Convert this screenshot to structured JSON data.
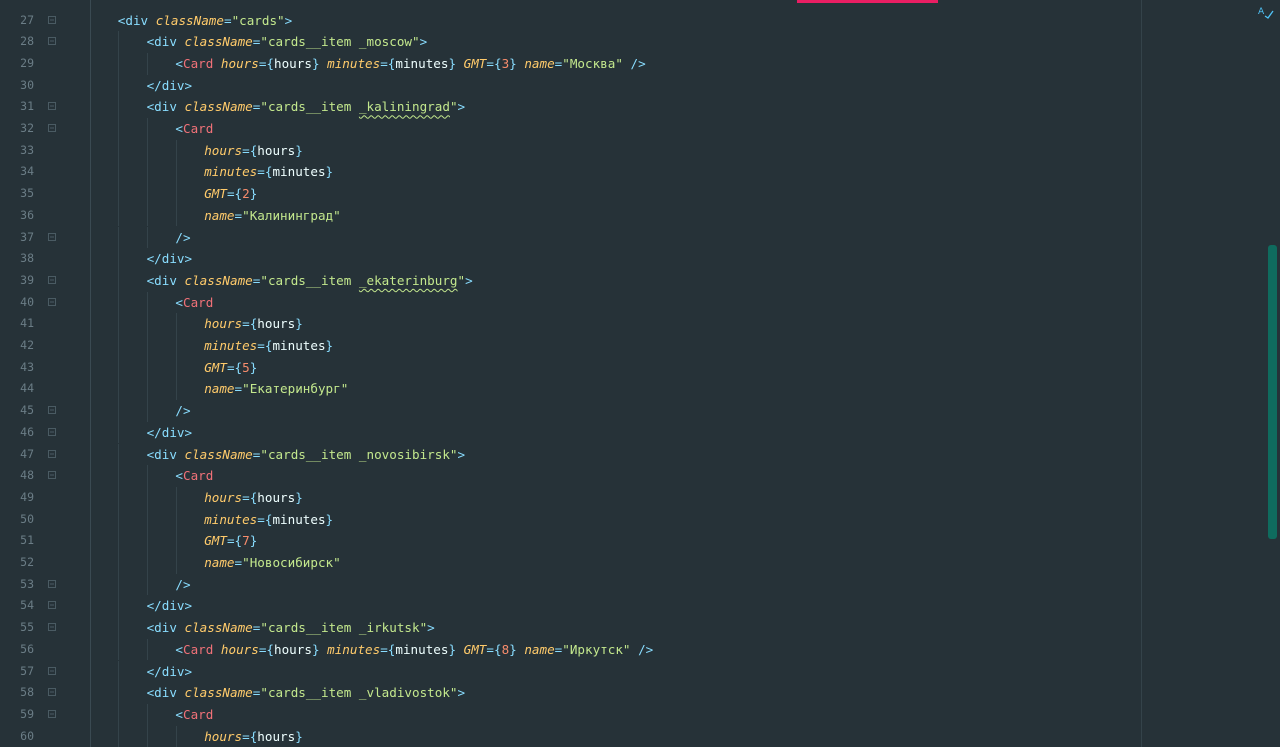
{
  "editor": {
    "lines": [
      {
        "n": "27",
        "indent": 1,
        "fold": true,
        "tokens": [
          [
            "t-tag",
            "<div "
          ],
          [
            "t-attr",
            "className"
          ],
          [
            "t-eq",
            "="
          ],
          [
            "t-str",
            "\"cards\""
          ],
          [
            "t-tag",
            ">"
          ]
        ]
      },
      {
        "n": "28",
        "indent": 2,
        "fold": true,
        "tokens": [
          [
            "t-tag",
            "<div "
          ],
          [
            "t-attr",
            "className"
          ],
          [
            "t-eq",
            "="
          ],
          [
            "t-str",
            "\"cards__item _moscow\""
          ],
          [
            "t-tag",
            ">"
          ]
        ]
      },
      {
        "n": "29",
        "indent": 3,
        "fold": false,
        "tokens": [
          [
            "t-tag",
            "<"
          ],
          [
            "t-comp",
            "Card "
          ],
          [
            "t-attr",
            "hours"
          ],
          [
            "t-eq",
            "="
          ],
          [
            "t-brace",
            "{"
          ],
          [
            "t-var",
            "hours"
          ],
          [
            "t-brace",
            "} "
          ],
          [
            "t-attr",
            "minutes"
          ],
          [
            "t-eq",
            "="
          ],
          [
            "t-brace",
            "{"
          ],
          [
            "t-var",
            "minutes"
          ],
          [
            "t-brace",
            "} "
          ],
          [
            "t-attr",
            "GMT"
          ],
          [
            "t-eq",
            "="
          ],
          [
            "t-brace",
            "{"
          ],
          [
            "t-num",
            "3"
          ],
          [
            "t-brace",
            "} "
          ],
          [
            "t-attr",
            "name"
          ],
          [
            "t-eq",
            "="
          ],
          [
            "t-str",
            "\"Москва\" "
          ],
          [
            "t-tag",
            "/>"
          ]
        ]
      },
      {
        "n": "30",
        "indent": 2,
        "fold": false,
        "tokens": [
          [
            "t-tag",
            "</div>"
          ]
        ]
      },
      {
        "n": "31",
        "indent": 2,
        "fold": true,
        "tokens": [
          [
            "t-tag",
            "<div "
          ],
          [
            "t-attr",
            "className"
          ],
          [
            "t-eq",
            "="
          ],
          [
            "t-str",
            "\"cards__item "
          ],
          [
            "t-str squig",
            "_kaliningrad"
          ],
          [
            "t-str",
            "\""
          ],
          [
            "t-tag",
            ">"
          ]
        ]
      },
      {
        "n": "32",
        "indent": 3,
        "fold": true,
        "tokens": [
          [
            "t-tag",
            "<"
          ],
          [
            "t-comp",
            "Card"
          ]
        ]
      },
      {
        "n": "33",
        "indent": 4,
        "fold": false,
        "tokens": [
          [
            "t-attr",
            "hours"
          ],
          [
            "t-eq",
            "="
          ],
          [
            "t-brace",
            "{"
          ],
          [
            "t-var",
            "hours"
          ],
          [
            "t-brace",
            "}"
          ]
        ]
      },
      {
        "n": "34",
        "indent": 4,
        "fold": false,
        "tokens": [
          [
            "t-attr",
            "minutes"
          ],
          [
            "t-eq",
            "="
          ],
          [
            "t-brace",
            "{"
          ],
          [
            "t-var",
            "minutes"
          ],
          [
            "t-brace",
            "}"
          ]
        ]
      },
      {
        "n": "35",
        "indent": 4,
        "fold": false,
        "tokens": [
          [
            "t-attr",
            "GMT"
          ],
          [
            "t-eq",
            "="
          ],
          [
            "t-brace",
            "{"
          ],
          [
            "t-num",
            "2"
          ],
          [
            "t-brace",
            "}"
          ]
        ]
      },
      {
        "n": "36",
        "indent": 4,
        "fold": false,
        "tokens": [
          [
            "t-attr",
            "name"
          ],
          [
            "t-eq",
            "="
          ],
          [
            "t-str",
            "\"Калининград\""
          ]
        ]
      },
      {
        "n": "37",
        "indent": 3,
        "fold": true,
        "tokens": [
          [
            "t-tag",
            "/>"
          ]
        ]
      },
      {
        "n": "38",
        "indent": 2,
        "fold": false,
        "tokens": [
          [
            "t-tag",
            "</div>"
          ]
        ]
      },
      {
        "n": "39",
        "indent": 2,
        "fold": true,
        "tokens": [
          [
            "t-tag",
            "<div "
          ],
          [
            "t-attr",
            "className"
          ],
          [
            "t-eq",
            "="
          ],
          [
            "t-str",
            "\"cards__item "
          ],
          [
            "t-str squig",
            "_ekaterinburg"
          ],
          [
            "t-str",
            "\""
          ],
          [
            "t-tag",
            ">"
          ]
        ]
      },
      {
        "n": "40",
        "indent": 3,
        "fold": true,
        "tokens": [
          [
            "t-tag",
            "<"
          ],
          [
            "t-comp",
            "Card"
          ]
        ]
      },
      {
        "n": "41",
        "indent": 4,
        "fold": false,
        "tokens": [
          [
            "t-attr",
            "hours"
          ],
          [
            "t-eq",
            "="
          ],
          [
            "t-brace",
            "{"
          ],
          [
            "t-var",
            "hours"
          ],
          [
            "t-brace",
            "}"
          ]
        ]
      },
      {
        "n": "42",
        "indent": 4,
        "fold": false,
        "tokens": [
          [
            "t-attr",
            "minutes"
          ],
          [
            "t-eq",
            "="
          ],
          [
            "t-brace",
            "{"
          ],
          [
            "t-var",
            "minutes"
          ],
          [
            "t-brace",
            "}"
          ]
        ]
      },
      {
        "n": "43",
        "indent": 4,
        "fold": false,
        "tokens": [
          [
            "t-attr",
            "GMT"
          ],
          [
            "t-eq",
            "="
          ],
          [
            "t-brace",
            "{"
          ],
          [
            "t-num",
            "5"
          ],
          [
            "t-brace",
            "}"
          ]
        ]
      },
      {
        "n": "44",
        "indent": 4,
        "fold": false,
        "tokens": [
          [
            "t-attr",
            "name"
          ],
          [
            "t-eq",
            "="
          ],
          [
            "t-str",
            "\"Екатеринбург\""
          ]
        ]
      },
      {
        "n": "45",
        "indent": 3,
        "fold": true,
        "tokens": [
          [
            "t-tag",
            "/>"
          ]
        ]
      },
      {
        "n": "46",
        "indent": 2,
        "fold": true,
        "tokens": [
          [
            "t-tag",
            "</div>"
          ]
        ]
      },
      {
        "n": "47",
        "indent": 2,
        "fold": true,
        "tokens": [
          [
            "t-tag",
            "<div "
          ],
          [
            "t-attr",
            "className"
          ],
          [
            "t-eq",
            "="
          ],
          [
            "t-str",
            "\"cards__item _novosibirsk\""
          ],
          [
            "t-tag",
            ">"
          ]
        ]
      },
      {
        "n": "48",
        "indent": 3,
        "fold": true,
        "tokens": [
          [
            "t-tag",
            "<"
          ],
          [
            "t-comp",
            "Card"
          ]
        ]
      },
      {
        "n": "49",
        "indent": 4,
        "fold": false,
        "tokens": [
          [
            "t-attr",
            "hours"
          ],
          [
            "t-eq",
            "="
          ],
          [
            "t-brace",
            "{"
          ],
          [
            "t-var",
            "hours"
          ],
          [
            "t-brace",
            "}"
          ]
        ]
      },
      {
        "n": "50",
        "indent": 4,
        "fold": false,
        "tokens": [
          [
            "t-attr",
            "minutes"
          ],
          [
            "t-eq",
            "="
          ],
          [
            "t-brace",
            "{"
          ],
          [
            "t-var",
            "minutes"
          ],
          [
            "t-brace",
            "}"
          ]
        ]
      },
      {
        "n": "51",
        "indent": 4,
        "fold": false,
        "tokens": [
          [
            "t-attr",
            "GMT"
          ],
          [
            "t-eq",
            "="
          ],
          [
            "t-brace",
            "{"
          ],
          [
            "t-num",
            "7"
          ],
          [
            "t-brace",
            "}"
          ]
        ]
      },
      {
        "n": "52",
        "indent": 4,
        "fold": false,
        "tokens": [
          [
            "t-attr",
            "name"
          ],
          [
            "t-eq",
            "="
          ],
          [
            "t-str",
            "\"Новосибирск\""
          ]
        ]
      },
      {
        "n": "53",
        "indent": 3,
        "fold": true,
        "tokens": [
          [
            "t-tag",
            "/>"
          ]
        ]
      },
      {
        "n": "54",
        "indent": 2,
        "fold": true,
        "tokens": [
          [
            "t-tag",
            "</div>"
          ]
        ]
      },
      {
        "n": "55",
        "indent": 2,
        "fold": true,
        "tokens": [
          [
            "t-tag",
            "<div "
          ],
          [
            "t-attr",
            "className"
          ],
          [
            "t-eq",
            "="
          ],
          [
            "t-str",
            "\"cards__item _irkutsk\""
          ],
          [
            "t-tag",
            ">"
          ]
        ]
      },
      {
        "n": "56",
        "indent": 3,
        "fold": false,
        "tokens": [
          [
            "t-tag",
            "<"
          ],
          [
            "t-comp",
            "Card "
          ],
          [
            "t-attr",
            "hours"
          ],
          [
            "t-eq",
            "="
          ],
          [
            "t-brace",
            "{"
          ],
          [
            "t-var",
            "hours"
          ],
          [
            "t-brace",
            "} "
          ],
          [
            "t-attr",
            "minutes"
          ],
          [
            "t-eq",
            "="
          ],
          [
            "t-brace",
            "{"
          ],
          [
            "t-var",
            "minutes"
          ],
          [
            "t-brace",
            "} "
          ],
          [
            "t-attr",
            "GMT"
          ],
          [
            "t-eq",
            "="
          ],
          [
            "t-brace",
            "{"
          ],
          [
            "t-num",
            "8"
          ],
          [
            "t-brace",
            "} "
          ],
          [
            "t-attr",
            "name"
          ],
          [
            "t-eq",
            "="
          ],
          [
            "t-str",
            "\"Иркутск\" "
          ],
          [
            "t-tag",
            "/>"
          ]
        ]
      },
      {
        "n": "57",
        "indent": 2,
        "fold": true,
        "tokens": [
          [
            "t-tag",
            "</div>"
          ]
        ]
      },
      {
        "n": "58",
        "indent": 2,
        "fold": true,
        "tokens": [
          [
            "t-tag",
            "<div "
          ],
          [
            "t-attr",
            "className"
          ],
          [
            "t-eq",
            "="
          ],
          [
            "t-str",
            "\"cards__item _vladivostok\""
          ],
          [
            "t-tag",
            ">"
          ]
        ]
      },
      {
        "n": "59",
        "indent": 3,
        "fold": true,
        "tokens": [
          [
            "t-tag",
            "<"
          ],
          [
            "t-comp",
            "Card"
          ]
        ]
      },
      {
        "n": "60",
        "indent": 4,
        "fold": false,
        "tokens": [
          [
            "t-attr",
            "hours"
          ],
          [
            "t-eq",
            "="
          ],
          [
            "t-brace",
            "{"
          ],
          [
            "t-var",
            "hours"
          ],
          [
            "t-brace",
            "}"
          ]
        ]
      }
    ]
  },
  "icons": {
    "fold_marker": "fold-marker-icon",
    "spellcheck": "spellcheck-icon"
  },
  "colors": {
    "background": "#263238",
    "accent": "#e91e63",
    "scrollbar": "#0f6b5e"
  }
}
